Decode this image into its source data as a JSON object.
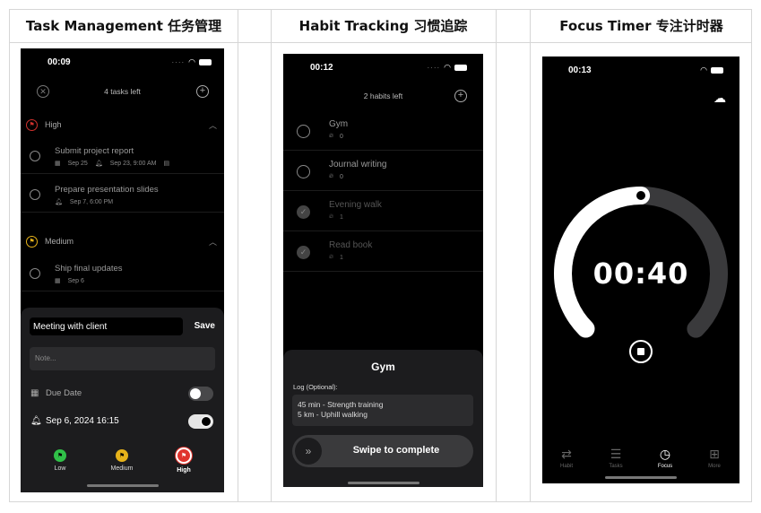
{
  "columns": [
    {
      "title": "Task Management  任务管理"
    },
    {
      "title": "Habit Tracking  习惯追踪"
    },
    {
      "title": "Focus Timer  专注计时器"
    }
  ],
  "task_panel": {
    "status_time": "00:09",
    "header": "4 tasks left",
    "sections": [
      {
        "label": "High",
        "color": "#d0312d",
        "tasks": [
          {
            "title": "Submit project report",
            "meta1": "Sep 25",
            "meta2": "Sep 23, 9:00 AM"
          },
          {
            "title": "Prepare presentation slides",
            "meta1": "Sep 7, 6:00 PM",
            "meta2": ""
          }
        ]
      },
      {
        "label": "Medium",
        "color": "#e6b21a",
        "tasks": [
          {
            "title": "Ship final updates",
            "meta1": "Sep 6",
            "meta2": ""
          }
        ]
      }
    ],
    "sheet": {
      "title_value": "Meeting with client",
      "save_label": "Save",
      "note_placeholder": "Note...",
      "due_date_label": "Due Date",
      "reminder_label": "Sep 6, 2024 16:15",
      "priorities": [
        {
          "label": "Low",
          "color": "#30c048"
        },
        {
          "label": "Medium",
          "color": "#e6b21a"
        },
        {
          "label": "High",
          "color": "#e0342e"
        }
      ]
    }
  },
  "habit_panel": {
    "status_time": "00:12",
    "header": "2 habits left",
    "habits": [
      {
        "name": "Gym",
        "streak": "0",
        "done": false
      },
      {
        "name": "Journal writing",
        "streak": "0",
        "done": false
      },
      {
        "name": "Evening walk",
        "streak": "1",
        "done": true
      },
      {
        "name": "Read book",
        "streak": "1",
        "done": true
      }
    ],
    "sheet": {
      "title": "Gym",
      "log_label": "Log (Optional):",
      "log_line1": "45 min - Strength training",
      "log_line2": "5 km - Uphill walking",
      "swipe_label": "Swipe to complete"
    }
  },
  "focus_panel": {
    "status_time": "00:13",
    "timer": "00:40",
    "progress": 0.5,
    "tabs": [
      {
        "label": "Habit",
        "icon": "repeat-icon"
      },
      {
        "label": "Tasks",
        "icon": "list-icon"
      },
      {
        "label": "Focus",
        "icon": "timer-icon"
      },
      {
        "label": "More",
        "icon": "grid-icon"
      }
    ]
  }
}
